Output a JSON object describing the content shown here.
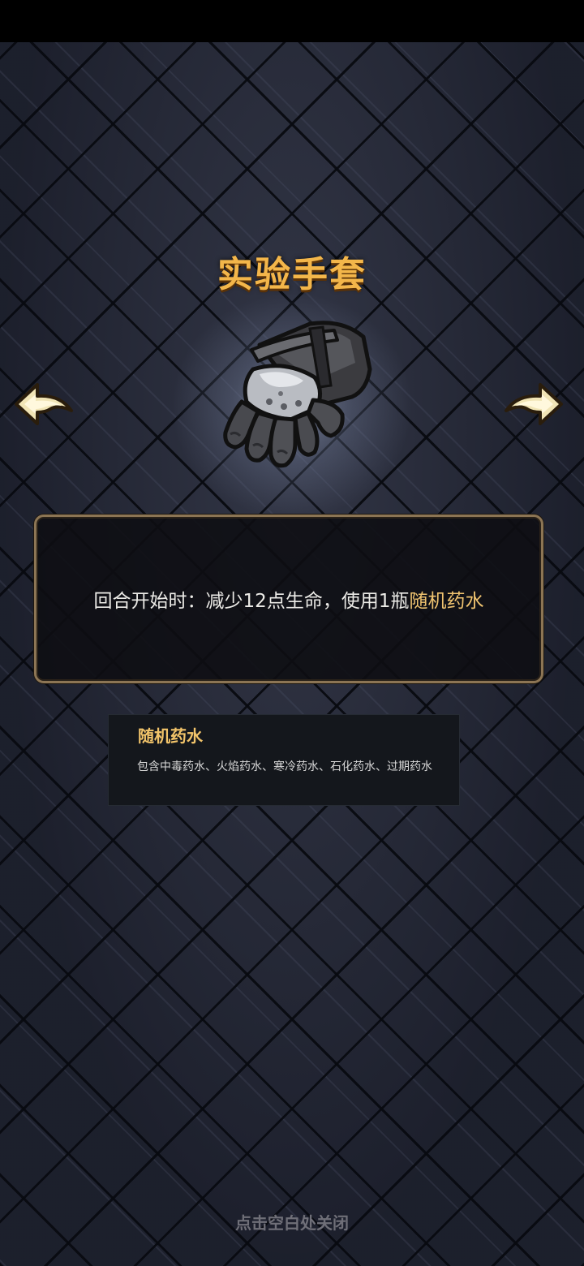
{
  "item": {
    "name": "实验手套",
    "icon": "gauntlet-icon"
  },
  "navigation": {
    "prev_icon": "arrow-left-icon",
    "next_icon": "arrow-right-icon"
  },
  "description": {
    "text_prefix": "回合开始时：减少12点生命，使用1瓶",
    "keyword": "随机药水"
  },
  "tooltip": {
    "title": "随机药水",
    "body": "包含中毒药水、火焰药水、寒冷药水、石化药水、过期药水"
  },
  "footer": {
    "close_hint": "点击空白处关闭"
  },
  "colors": {
    "title": "#f3b64a",
    "keyword": "#f0c470",
    "panel_border": "#8c7554",
    "background": "#262a3b"
  }
}
